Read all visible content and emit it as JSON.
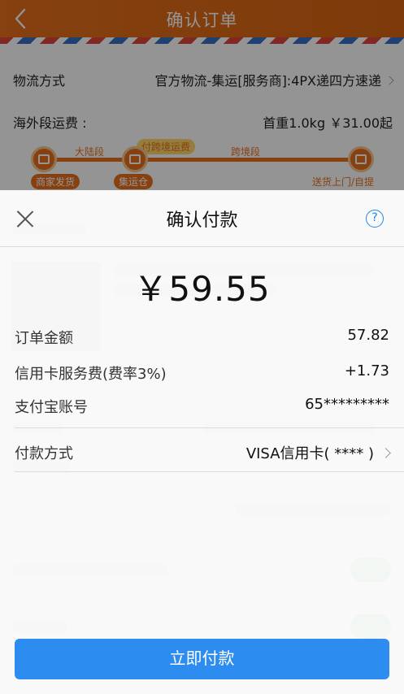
{
  "nav": {
    "title": "确认订单"
  },
  "order": {
    "logistics_label": "物流方式",
    "logistics_value": "官方物流-集运[服务商]:4PX递四方速递",
    "overseas_fee_label": "海外段运费 :",
    "overseas_fee_value": "首重1.0kg ￥31.00起"
  },
  "route": {
    "segment_mainland": "大陆段",
    "segment_cross_border": "跨境段",
    "bubble": "付跨境运费",
    "node_merchant": "商家发货",
    "node_warehouse": "集运仓",
    "node_delivery": "送货上门/自提"
  },
  "payment": {
    "title": "确认付款",
    "help_glyph": "?",
    "amount": "￥59.55",
    "order_amount_label": "订单金额",
    "order_amount_value": "57.82",
    "card_fee_label": "信用卡服务费(费率3%)",
    "card_fee_value": "+1.73",
    "alipay_account_label": "支付宝账号",
    "alipay_account_value": "65*********",
    "pay_method_label": "付款方式",
    "pay_method_value": "VISA信用卡( **** )",
    "pay_button": "立即付款"
  },
  "colors": {
    "accent_orange": "#e8701c",
    "pay_blue": "#2d8cf0",
    "help_blue": "#1e88e5"
  }
}
